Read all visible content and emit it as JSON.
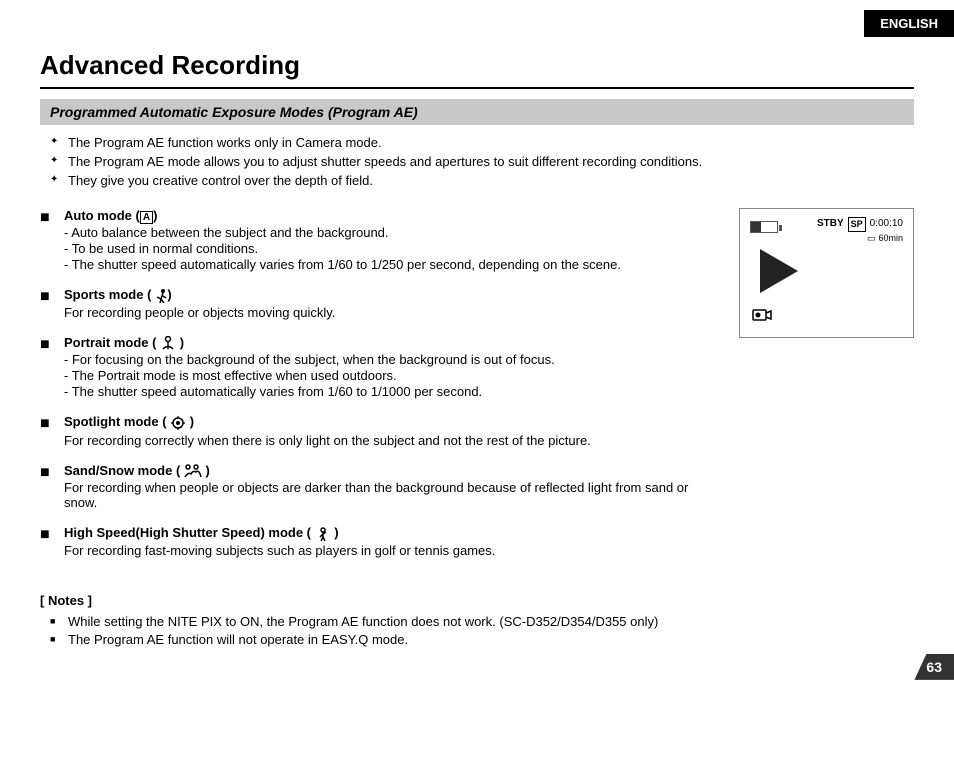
{
  "badge": {
    "label": "ENGLISH"
  },
  "title": "Advanced Recording",
  "section_header": "Programmed Automatic Exposure Modes (Program AE)",
  "intro_bullets": [
    "The Program AE function works only in Camera mode.",
    "The Program AE mode allows you to adjust shutter speeds and apertures to suit different recording conditions.",
    "They give you creative control over the depth of field."
  ],
  "modes": [
    {
      "title": "Auto mode (▣)",
      "lines": [
        "- Auto balance between the subject and the background.",
        "- To be used in normal conditions.",
        "- The shutter speed automatically varies from 1/60 to 1/250 per second, depending on the scene."
      ]
    },
    {
      "title": "Sports mode (🏃)",
      "lines": [
        "For recording people or objects moving quickly."
      ]
    },
    {
      "title": "Portrait mode ( 👤)",
      "lines": [
        "- For focusing on the background of the subject, when the background is out of focus.",
        "- The Portrait mode is most effective when used outdoors.",
        "- The shutter speed automatically varies from 1/60 to 1/1000 per second."
      ]
    },
    {
      "title": "Spotlight mode ( ☉ )",
      "lines": [
        "For recording correctly when there is only light on the subject and not the rest of the picture."
      ]
    },
    {
      "title": "Sand/Snow mode ( ☃)",
      "lines": [
        "For recording when people or objects are darker than the background because of reflected light from sand or snow."
      ]
    },
    {
      "title": "High Speed(High Shutter Speed) mode ( 🎭 )",
      "lines": [
        "For recording fast-moving subjects such as players in golf or tennis games."
      ]
    }
  ],
  "camera_display": {
    "stby": "STBY",
    "sp": "SP",
    "time": "0:00:10",
    "tape": "60min"
  },
  "notes": {
    "title": "[ Notes ]",
    "items": [
      "While setting the NITE PIX to ON, the Program AE function does not work. (SC-D352/D354/D355 only)",
      "The Program AE function will not operate in EASY.Q mode."
    ]
  },
  "page_number": "63"
}
